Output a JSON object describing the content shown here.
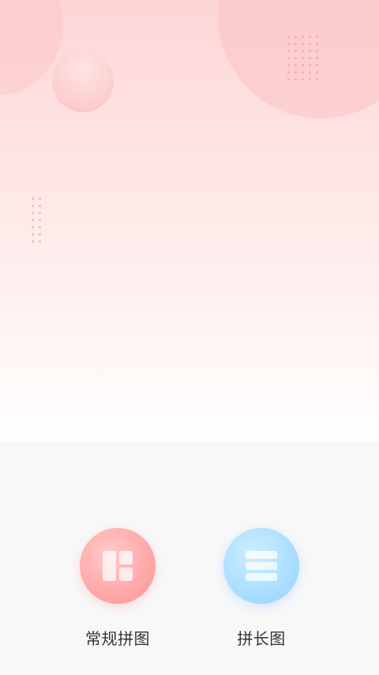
{
  "actions": {
    "regular_collage": {
      "label": "常规拼图",
      "icon": "grid-collage-icon",
      "color": "#ff9d9d"
    },
    "long_collage": {
      "label": "拼长图",
      "icon": "stacked-rows-icon",
      "color": "#9fd8ff"
    }
  }
}
